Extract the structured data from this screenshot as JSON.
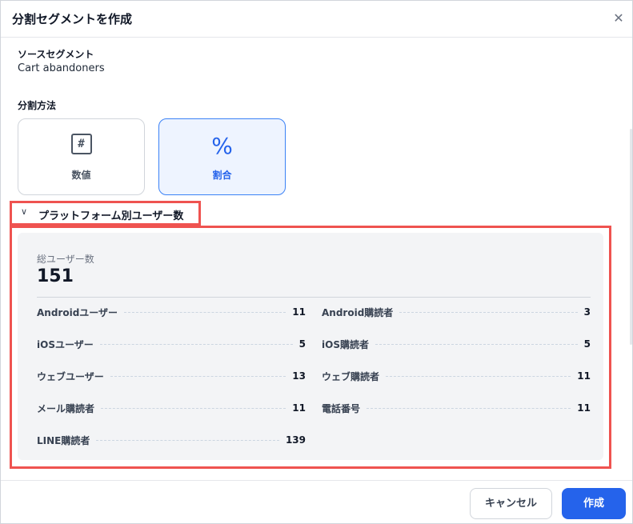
{
  "dialog": {
    "title": "分割セグメントを作成",
    "close_icon": "close-icon"
  },
  "source": {
    "label": "ソースセグメント",
    "value": "Cart abandoners"
  },
  "split_method": {
    "label": "分割方法",
    "options": [
      {
        "label": "数値",
        "icon": "hash-icon",
        "selected": false
      },
      {
        "label": "割合",
        "icon": "percent-icon",
        "selected": true
      }
    ]
  },
  "platform_section": {
    "title": "プラットフォーム別ユーザー数",
    "expanded": true,
    "total_label": "総ユーザー数",
    "total_value": "151",
    "stats": [
      {
        "label": "Androidユーザー",
        "value": "11"
      },
      {
        "label": "Android購読者",
        "value": "3"
      },
      {
        "label": "iOSユーザー",
        "value": "5"
      },
      {
        "label": "iOS購読者",
        "value": "5"
      },
      {
        "label": "ウェブユーザー",
        "value": "13"
      },
      {
        "label": "ウェブ購読者",
        "value": "11"
      },
      {
        "label": "メール購読者",
        "value": "11"
      },
      {
        "label": "電話番号",
        "value": "11"
      },
      {
        "label": "LINE購読者",
        "value": "139"
      }
    ]
  },
  "footer": {
    "cancel_label": "キャンセル",
    "create_label": "作成"
  },
  "colors": {
    "accent": "#2563eb",
    "highlight_border": "#ef5350",
    "panel_bg": "#f3f4f6"
  }
}
